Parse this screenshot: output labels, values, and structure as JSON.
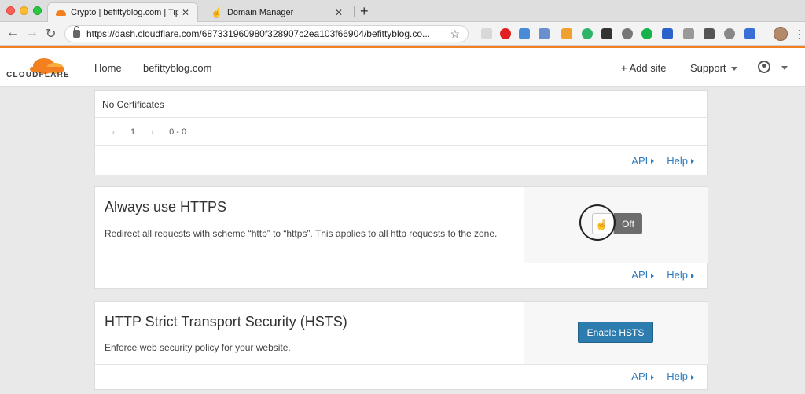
{
  "browser": {
    "tabs": [
      {
        "title": "Crypto | befittyblog.com | Tips",
        "active": true
      },
      {
        "title": "Domain Manager",
        "active": false
      }
    ],
    "url": "https://dash.cloudflare.com/687331960980f328907c2ea103f66904/befittyblog.co..."
  },
  "header": {
    "logo_text": "CLOUDFLARE",
    "nav": [
      "Home",
      "befittyblog.com"
    ],
    "add_site": "+ Add site",
    "support": "Support"
  },
  "certificates": {
    "empty_label": "No Certificates",
    "pager": {
      "page": "1",
      "range": "0 - 0"
    },
    "api_label": "API",
    "help_label": "Help"
  },
  "always_https": {
    "title": "Always use HTTPS",
    "description": "Redirect all requests with scheme “http” to “https”. This applies to all http requests to the zone.",
    "toggle_state": "Off",
    "api_label": "API",
    "help_label": "Help"
  },
  "hsts": {
    "title": "HTTP Strict Transport Security (HSTS)",
    "description": "Enforce web security policy for your website.",
    "button_label": "Enable HSTS",
    "api_label": "API",
    "help_label": "Help"
  },
  "colors": {
    "brand_orange": "#f38020",
    "link_blue": "#2f7bbf",
    "button_blue": "#2c7cb0"
  }
}
